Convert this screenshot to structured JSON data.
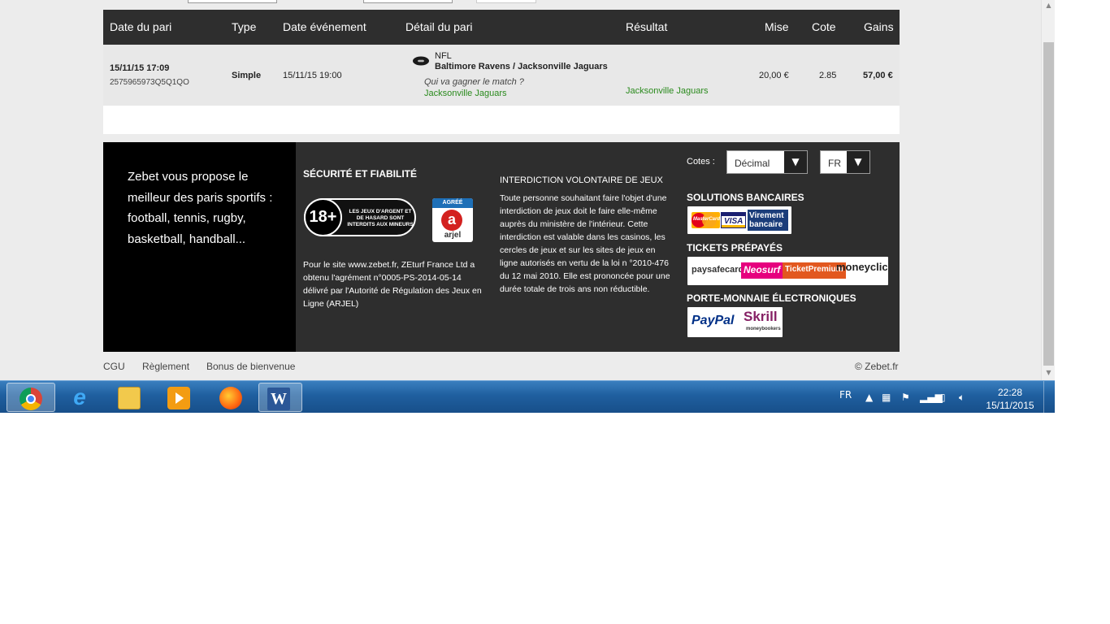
{
  "table": {
    "headers": {
      "date_pari": "Date du pari",
      "type": "Type",
      "date_event": "Date événement",
      "detail": "Détail du pari",
      "resultat": "Résultat",
      "mise": "Mise",
      "cote": "Cote",
      "gains": "Gains"
    },
    "row": {
      "date_pari": "15/11/15 17:09",
      "ref": "2575965973Q5Q1QO",
      "type": "Simple",
      "date_event": "15/11/15 19:00",
      "sport": "NFL",
      "match": "Baltimore Ravens / Jacksonville Jaguars",
      "question": "Qui va gagner le match ?",
      "selection": "Jacksonville Jaguars",
      "resultat": "Jacksonville Jaguars",
      "mise": "20,00 €",
      "cote": "2.85",
      "gains": "57,00 €"
    }
  },
  "footer": {
    "promo": "Zebet vous propose le meilleur des paris sportifs : football, tennis, rugby, basketball, handball...",
    "securite_title": "SÉCURITÉ ET FIABILITÉ",
    "badge18_circle": "18+",
    "badge18_text": "LES JEUX D'ARGENT ET DE HASARD SONT INTERDITS AUX MINEURS",
    "arjel_top": "AGRÉÉ",
    "arjel_letter": "a",
    "arjel_name": "arjel",
    "securite_text": "Pour le site www.zebet.fr, ZEturf France Ltd a obtenu l'agrément n°0005-PS-2014-05-14 délivré par l'Autorité de Régulation des Jeux en Ligne (ARJEL)",
    "interdiction_title": "INTERDICTION VOLONTAIRE DE JEUX",
    "interdiction_text": "Toute personne souhaitant faire l'objet d'une interdiction de jeux doit le faire elle-même auprès du ministère de l'intérieur. Cette interdiction est valable dans les casinos, les cercles de jeux et sur les sites de jeux en ligne autorisés en vertu de la loi n °2010-476 du 12 mai 2010. Elle est prononcée pour une durée totale de trois ans non réductible.",
    "cotes_label": "Cotes :",
    "cotes_value": "Décimal",
    "lang_value": "FR",
    "bank_title": "SOLUTIONS BANCAIRES",
    "bank_logos": [
      "MasterCard",
      "VISA",
      "Virement bancaire"
    ],
    "tickets_title": "TICKETS PRÉPAYÉS",
    "ticket_logos": [
      "paysafecard",
      "Neosurf",
      "TicketPremium",
      "moneyclic"
    ],
    "wallet_title": "PORTE-MONNAIE ÉLECTRONIQUES",
    "wallet_logos": [
      "PayPal",
      "Skrill",
      "moneybookers"
    ]
  },
  "links": [
    "CGU",
    "Règlement",
    "Bonus de bienvenue"
  ],
  "copyright": "© Zebet.fr",
  "taskbar": {
    "apps": [
      "chrome-icon",
      "internet-explorer-icon",
      "file-explorer-icon",
      "media-player-icon",
      "firefox-icon",
      "word-icon"
    ],
    "lang": "FR",
    "time": "22:28",
    "date": "15/11/2015"
  },
  "colors": {
    "header_bg": "#2e2e2e",
    "row_bg": "#e8e8e8",
    "result_green": "#2a8a1d",
    "taskbar": "#1f5f9f"
  }
}
